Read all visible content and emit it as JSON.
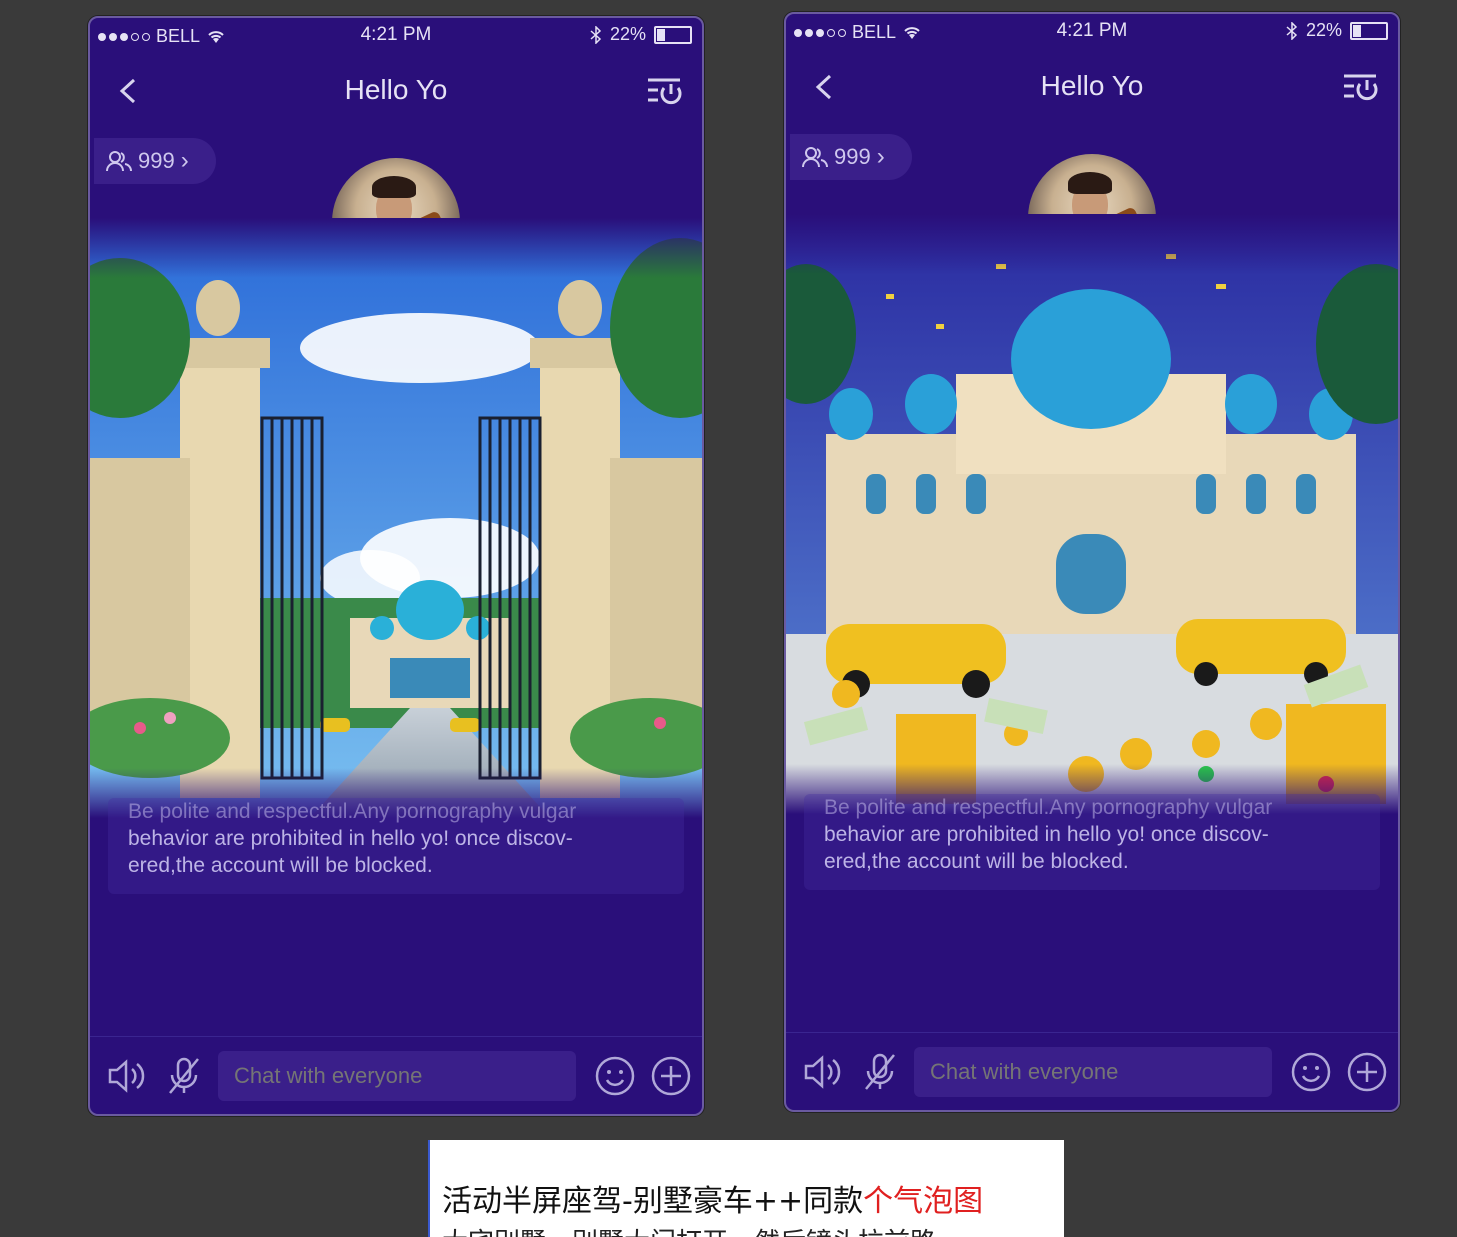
{
  "colors": {
    "phone_bg": "#2a0f7a",
    "text_light": "#e6e2f5",
    "pill_bg": "#3a1f8a",
    "caption_red": "#e02020",
    "background": "#3a3a3a"
  },
  "status_bar": {
    "carrier": "BELL",
    "time": "4:21 PM",
    "battery": "22%",
    "icons": [
      "signal-dots-icon",
      "wifi-icon",
      "bluetooth-icon",
      "battery-icon"
    ]
  },
  "phones": [
    {
      "variant": "gate",
      "title": "Hello Yo",
      "members": "999",
      "notice": {
        "line1": "Be polite and respectful.Any pornography vulgar",
        "line2": "behavior are prohibited in hello yo! once discov-",
        "line3": "ered,the account will be blocked."
      },
      "chat_placeholder": "Chat with everyone"
    },
    {
      "variant": "villa",
      "title": "Hello Yo",
      "members": "999",
      "notice": {
        "line1": "Be polite and respectful.Any pornography vulgar",
        "line2": "behavior are prohibited in hello yo! once discov-",
        "line3": "ered,the account will be blocked."
      },
      "chat_placeholder": "Chat with everyone"
    }
  ],
  "caption": {
    "text_black": "活动半屏座驾-别墅豪车++同款",
    "text_red": "个气泡图",
    "line2": "大宅别墅，别墅大门打开，然后镜头拉前路"
  }
}
